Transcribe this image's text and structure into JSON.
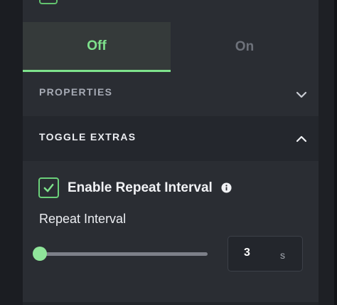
{
  "tabs": [
    {
      "label": "Off",
      "active": true
    },
    {
      "label": "On",
      "active": false
    }
  ],
  "sections": {
    "properties": {
      "title": "PROPERTIES",
      "expanded": false,
      "icon": "chevron-down-icon"
    },
    "toggle_extras": {
      "title": "TOGGLE EXTRAS",
      "expanded": true,
      "icon": "chevron-up-icon"
    }
  },
  "enable_repeat": {
    "label": "Enable Repeat Interval",
    "checked": true,
    "info_icon": "info-icon"
  },
  "repeat_interval": {
    "label": "Repeat Interval",
    "value": "3",
    "unit": "s",
    "slider_fraction": 0.0
  },
  "colors": {
    "accent": "#7ee28c",
    "panel": "#2a2d33",
    "background": "#1b1d22"
  }
}
